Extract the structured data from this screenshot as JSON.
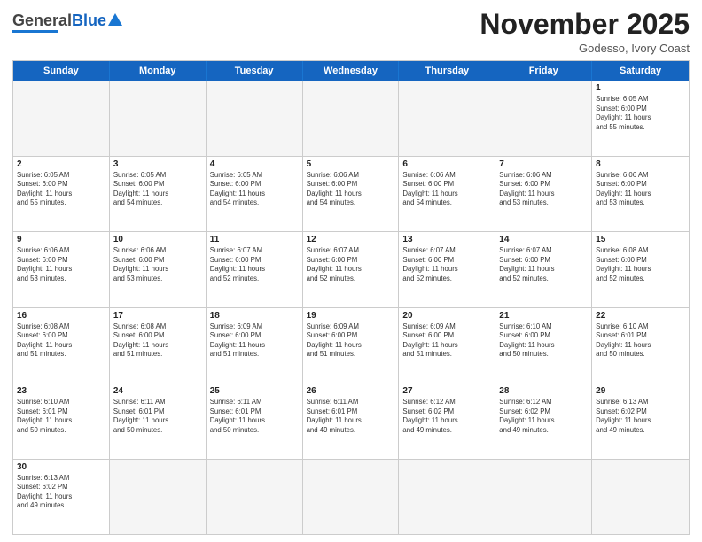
{
  "header": {
    "logo": {
      "general": "General",
      "blue": "Blue"
    },
    "title": "November 2025",
    "subtitle": "Godesso, Ivory Coast"
  },
  "weekdays": [
    "Sunday",
    "Monday",
    "Tuesday",
    "Wednesday",
    "Thursday",
    "Friday",
    "Saturday"
  ],
  "rows": [
    {
      "cells": [
        {
          "day": "",
          "empty": true,
          "text": ""
        },
        {
          "day": "",
          "empty": true,
          "text": ""
        },
        {
          "day": "",
          "empty": true,
          "text": ""
        },
        {
          "day": "",
          "empty": true,
          "text": ""
        },
        {
          "day": "",
          "empty": true,
          "text": ""
        },
        {
          "day": "",
          "empty": true,
          "text": ""
        },
        {
          "day": "1",
          "empty": false,
          "text": "Sunrise: 6:05 AM\nSunset: 6:00 PM\nDaylight: 11 hours\nand 55 minutes."
        }
      ]
    },
    {
      "cells": [
        {
          "day": "2",
          "empty": false,
          "text": "Sunrise: 6:05 AM\nSunset: 6:00 PM\nDaylight: 11 hours\nand 55 minutes."
        },
        {
          "day": "3",
          "empty": false,
          "text": "Sunrise: 6:05 AM\nSunset: 6:00 PM\nDaylight: 11 hours\nand 54 minutes."
        },
        {
          "day": "4",
          "empty": false,
          "text": "Sunrise: 6:05 AM\nSunset: 6:00 PM\nDaylight: 11 hours\nand 54 minutes."
        },
        {
          "day": "5",
          "empty": false,
          "text": "Sunrise: 6:06 AM\nSunset: 6:00 PM\nDaylight: 11 hours\nand 54 minutes."
        },
        {
          "day": "6",
          "empty": false,
          "text": "Sunrise: 6:06 AM\nSunset: 6:00 PM\nDaylight: 11 hours\nand 54 minutes."
        },
        {
          "day": "7",
          "empty": false,
          "text": "Sunrise: 6:06 AM\nSunset: 6:00 PM\nDaylight: 11 hours\nand 53 minutes."
        },
        {
          "day": "8",
          "empty": false,
          "text": "Sunrise: 6:06 AM\nSunset: 6:00 PM\nDaylight: 11 hours\nand 53 minutes."
        }
      ]
    },
    {
      "cells": [
        {
          "day": "9",
          "empty": false,
          "text": "Sunrise: 6:06 AM\nSunset: 6:00 PM\nDaylight: 11 hours\nand 53 minutes."
        },
        {
          "day": "10",
          "empty": false,
          "text": "Sunrise: 6:06 AM\nSunset: 6:00 PM\nDaylight: 11 hours\nand 53 minutes."
        },
        {
          "day": "11",
          "empty": false,
          "text": "Sunrise: 6:07 AM\nSunset: 6:00 PM\nDaylight: 11 hours\nand 52 minutes."
        },
        {
          "day": "12",
          "empty": false,
          "text": "Sunrise: 6:07 AM\nSunset: 6:00 PM\nDaylight: 11 hours\nand 52 minutes."
        },
        {
          "day": "13",
          "empty": false,
          "text": "Sunrise: 6:07 AM\nSunset: 6:00 PM\nDaylight: 11 hours\nand 52 minutes."
        },
        {
          "day": "14",
          "empty": false,
          "text": "Sunrise: 6:07 AM\nSunset: 6:00 PM\nDaylight: 11 hours\nand 52 minutes."
        },
        {
          "day": "15",
          "empty": false,
          "text": "Sunrise: 6:08 AM\nSunset: 6:00 PM\nDaylight: 11 hours\nand 52 minutes."
        }
      ]
    },
    {
      "cells": [
        {
          "day": "16",
          "empty": false,
          "text": "Sunrise: 6:08 AM\nSunset: 6:00 PM\nDaylight: 11 hours\nand 51 minutes."
        },
        {
          "day": "17",
          "empty": false,
          "text": "Sunrise: 6:08 AM\nSunset: 6:00 PM\nDaylight: 11 hours\nand 51 minutes."
        },
        {
          "day": "18",
          "empty": false,
          "text": "Sunrise: 6:09 AM\nSunset: 6:00 PM\nDaylight: 11 hours\nand 51 minutes."
        },
        {
          "day": "19",
          "empty": false,
          "text": "Sunrise: 6:09 AM\nSunset: 6:00 PM\nDaylight: 11 hours\nand 51 minutes."
        },
        {
          "day": "20",
          "empty": false,
          "text": "Sunrise: 6:09 AM\nSunset: 6:00 PM\nDaylight: 11 hours\nand 51 minutes."
        },
        {
          "day": "21",
          "empty": false,
          "text": "Sunrise: 6:10 AM\nSunset: 6:00 PM\nDaylight: 11 hours\nand 50 minutes."
        },
        {
          "day": "22",
          "empty": false,
          "text": "Sunrise: 6:10 AM\nSunset: 6:01 PM\nDaylight: 11 hours\nand 50 minutes."
        }
      ]
    },
    {
      "cells": [
        {
          "day": "23",
          "empty": false,
          "text": "Sunrise: 6:10 AM\nSunset: 6:01 PM\nDaylight: 11 hours\nand 50 minutes."
        },
        {
          "day": "24",
          "empty": false,
          "text": "Sunrise: 6:11 AM\nSunset: 6:01 PM\nDaylight: 11 hours\nand 50 minutes."
        },
        {
          "day": "25",
          "empty": false,
          "text": "Sunrise: 6:11 AM\nSunset: 6:01 PM\nDaylight: 11 hours\nand 50 minutes."
        },
        {
          "day": "26",
          "empty": false,
          "text": "Sunrise: 6:11 AM\nSunset: 6:01 PM\nDaylight: 11 hours\nand 49 minutes."
        },
        {
          "day": "27",
          "empty": false,
          "text": "Sunrise: 6:12 AM\nSunset: 6:02 PM\nDaylight: 11 hours\nand 49 minutes."
        },
        {
          "day": "28",
          "empty": false,
          "text": "Sunrise: 6:12 AM\nSunset: 6:02 PM\nDaylight: 11 hours\nand 49 minutes."
        },
        {
          "day": "29",
          "empty": false,
          "text": "Sunrise: 6:13 AM\nSunset: 6:02 PM\nDaylight: 11 hours\nand 49 minutes."
        }
      ]
    },
    {
      "cells": [
        {
          "day": "30",
          "empty": false,
          "text": "Sunrise: 6:13 AM\nSunset: 6:02 PM\nDaylight: 11 hours\nand 49 minutes."
        },
        {
          "day": "",
          "empty": true,
          "text": ""
        },
        {
          "day": "",
          "empty": true,
          "text": ""
        },
        {
          "day": "",
          "empty": true,
          "text": ""
        },
        {
          "day": "",
          "empty": true,
          "text": ""
        },
        {
          "day": "",
          "empty": true,
          "text": ""
        },
        {
          "day": "",
          "empty": true,
          "text": ""
        }
      ]
    }
  ]
}
